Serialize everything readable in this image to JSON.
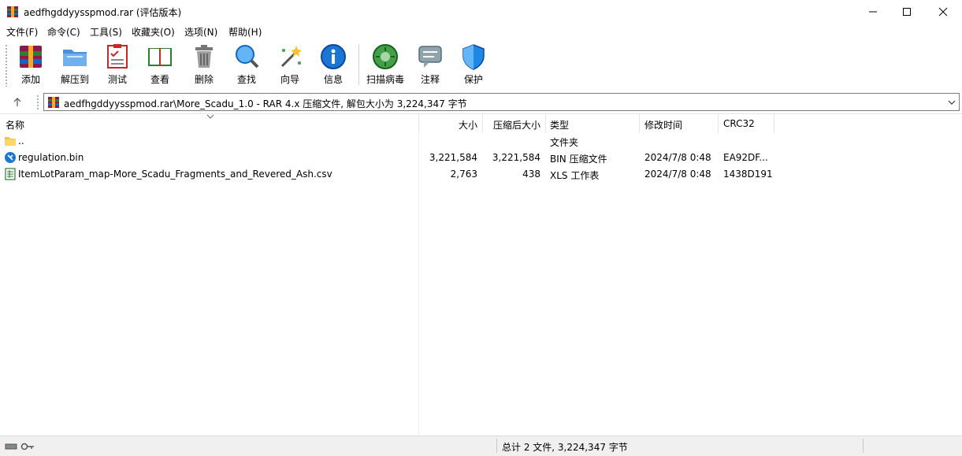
{
  "window": {
    "title": "aedfhgddyysspmod.rar (评估版本)",
    "controls": {
      "minimize": "minimize-icon",
      "maximize": "maximize-icon",
      "close": "close-icon"
    }
  },
  "menu": [
    "文件(F)",
    "命令(C)",
    "工具(S)",
    "收藏夹(O)",
    "选项(N)",
    "帮助(H)"
  ],
  "toolbar": [
    {
      "label": "添加",
      "icon": "add-archive-icon"
    },
    {
      "label": "解压到",
      "icon": "extract-folder-icon"
    },
    {
      "label": "测试",
      "icon": "test-checklist-icon"
    },
    {
      "label": "查看",
      "icon": "view-book-icon"
    },
    {
      "label": "删除",
      "icon": "trash-icon"
    },
    {
      "label": "查找",
      "icon": "magnifier-icon"
    },
    {
      "label": "向导",
      "icon": "wizard-wand-icon"
    },
    {
      "label": "信息",
      "icon": "info-icon"
    },
    {
      "label": "扫描病毒",
      "icon": "virus-scan-icon"
    },
    {
      "label": "注释",
      "icon": "comment-icon"
    },
    {
      "label": "保护",
      "icon": "shield-icon"
    }
  ],
  "address": {
    "path": "aedfhgddyysspmod.rar\\More_Scadu_1.0 - RAR 4.x 压缩文件, 解包大小为 3,224,347 字节"
  },
  "columns": {
    "name": "名称",
    "size": "大小",
    "packed": "压缩后大小",
    "type": "类型",
    "modified": "修改时间",
    "crc": "CRC32"
  },
  "files": [
    {
      "name": "..",
      "size": "",
      "packed": "",
      "type": "文件夹",
      "modified": "",
      "crc": "",
      "icon": "folder-icon"
    },
    {
      "name": "regulation.bin",
      "size": "3,221,584",
      "packed": "3,221,584",
      "type": "BIN 压缩文件",
      "modified": "2024/7/8 0:48",
      "crc": "EA92DF...",
      "icon": "bin-file-icon"
    },
    {
      "name": "ItemLotParam_map-More_Scadu_Fragments_and_Revered_Ash.csv",
      "size": "2,763",
      "packed": "438",
      "type": "XLS 工作表",
      "modified": "2024/7/8 0:48",
      "crc": "1438D191",
      "icon": "spreadsheet-file-icon"
    }
  ],
  "status": {
    "summary": "总计 2 文件, 3,224,347 字节",
    "left_icons": [
      "drive-icon",
      "key-icon"
    ]
  }
}
